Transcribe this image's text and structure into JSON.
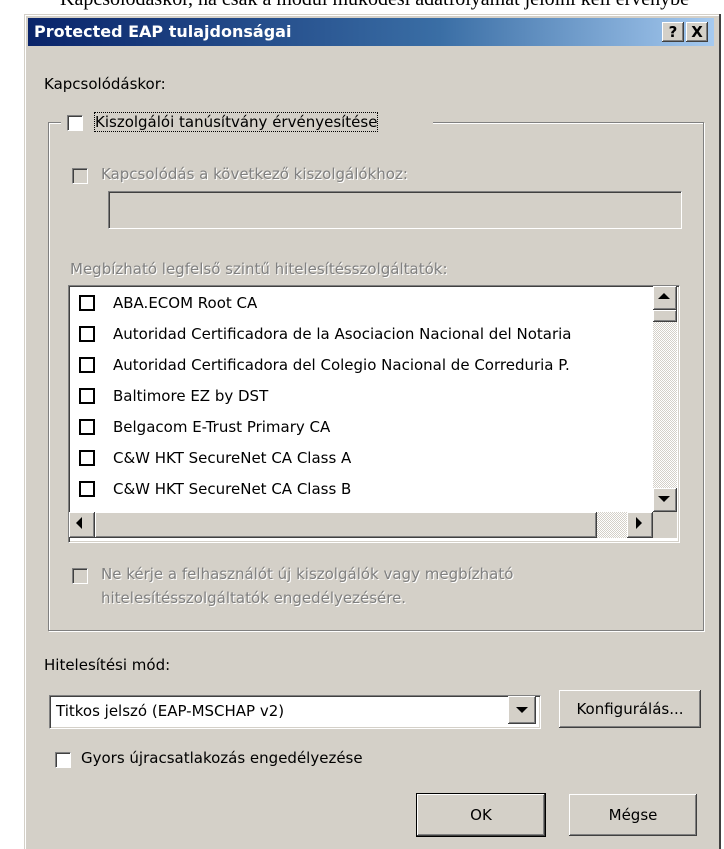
{
  "top_text": "Kapcsolódáskor, ha csak a modul működési adatfolyamát jelölni kell érvénybe",
  "window": {
    "title": "Protected EAP tulajdonságai",
    "help_button": "?",
    "close_button": "X"
  },
  "connect_label": "Kapcsolódáskor:",
  "validate_cert": {
    "label": "Kiszolgálói tanúsítvány érvényesítése",
    "checked": false
  },
  "connect_servers": {
    "label": "Kapcsolódás a következő kiszolgálókhoz:",
    "checked": false,
    "value": ""
  },
  "trusted_ca": {
    "label": "Megbízható legfelső szintű hitelesítésszolgáltatók:",
    "items": [
      "ABA.ECOM Root CA",
      "Autoridad Certificadora de la Asociacion Nacional del Notaria",
      "Autoridad Certificadora del Colegio Nacional de Correduria P.",
      "Baltimore EZ by DST",
      "Belgacom E-Trust Primary CA",
      "C&W HKT SecureNet CA Class A",
      "C&W HKT SecureNet CA Class B"
    ]
  },
  "no_prompt": {
    "line1": "Ne kérje a felhasználót új kiszolgálók vagy megbízható",
    "line2": "hitelesítésszolgáltatók engedélyezésére.",
    "checked": false
  },
  "auth_method": {
    "label": "Hitelesítési mód:",
    "selected": "Titkos jelszó (EAP-MSCHAP v2)",
    "configure_button": "Konfigurálás..."
  },
  "fast_reconnect": {
    "label": "Gyors újracsatlakozás engedélyezése",
    "checked": false
  },
  "buttons": {
    "ok": "OK",
    "cancel": "Mégse"
  }
}
